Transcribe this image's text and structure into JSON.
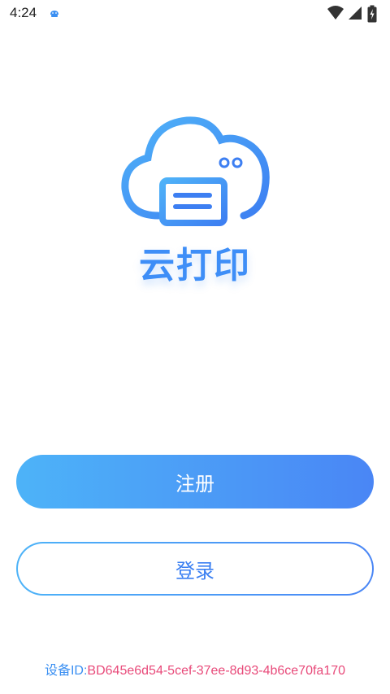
{
  "status_bar": {
    "time": "4:24",
    "icons": [
      "app-notification-icon",
      "wifi-icon",
      "cellular-signal-icon",
      "battery-charging-icon"
    ]
  },
  "logo": {
    "text": "云打印",
    "icon": "cloud-printer-icon",
    "color": "#3e8ef7"
  },
  "buttons": {
    "register_label": "注册",
    "login_label": "登录"
  },
  "device": {
    "label": "设备ID:",
    "value": "BD645e6d54-5cef-37ee-8d93-4b6ce70fa170"
  },
  "colors": {
    "accent_start": "#4db3f8",
    "accent_end": "#4a86f5",
    "device_id_value": "#e84a7a"
  }
}
